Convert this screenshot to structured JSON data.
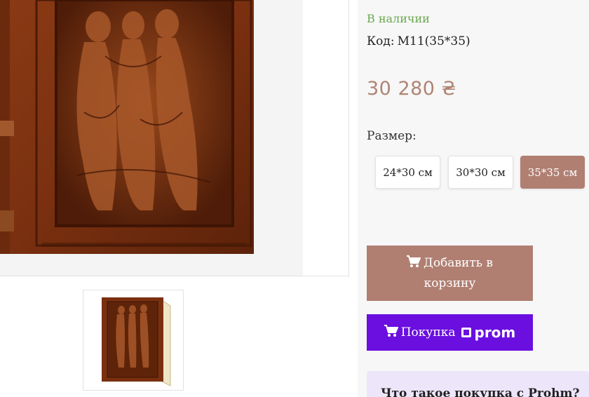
{
  "product": {
    "stock_status": "В наличии",
    "code_label": "Код:",
    "code_value": "M11(35*35)",
    "price": "30 280 ₴",
    "size_label": "Размер:",
    "sizes": [
      {
        "label": "24*30 см",
        "selected": false
      },
      {
        "label": "30*30 см",
        "selected": false
      },
      {
        "label": "35*35 см",
        "selected": true
      }
    ]
  },
  "actions": {
    "add_to_cart_line1": "Добавить в",
    "add_to_cart_line2": "корзину",
    "prom_buy_label": "Покупка",
    "prom_brand": "prom"
  },
  "promo": {
    "question": "Что такое покупка с Prohm?"
  },
  "colors": {
    "accent": "#b07f72",
    "stock_green": "#6aa84f",
    "prom_purple": "#6a0fe0",
    "price": "#b08474"
  },
  "icons": {
    "cart": "shopping-cart-icon",
    "prom": "prom-logo-icon"
  }
}
